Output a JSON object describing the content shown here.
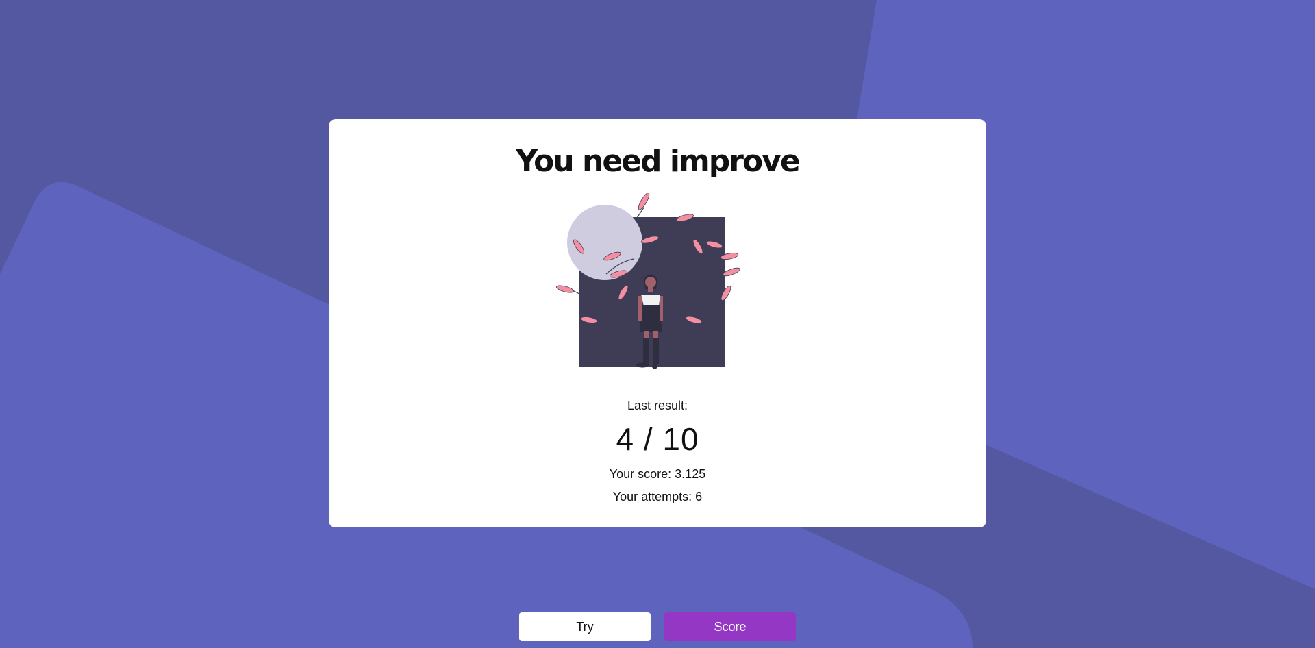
{
  "colors": {
    "background": "#5458a0",
    "shape": "#5e63bd",
    "card": "#ffffff",
    "accent": "#9437c4"
  },
  "card": {
    "title": "You need improve",
    "illustration": "woman-standing-with-falling-leaves-illustration",
    "last_result_label": "Last result:",
    "result": "4 / 10",
    "score_text": "Your score: 3.125",
    "attempts_text": "Your attempts: 6"
  },
  "buttons": {
    "try_label": "Try",
    "score_label": "Score"
  }
}
